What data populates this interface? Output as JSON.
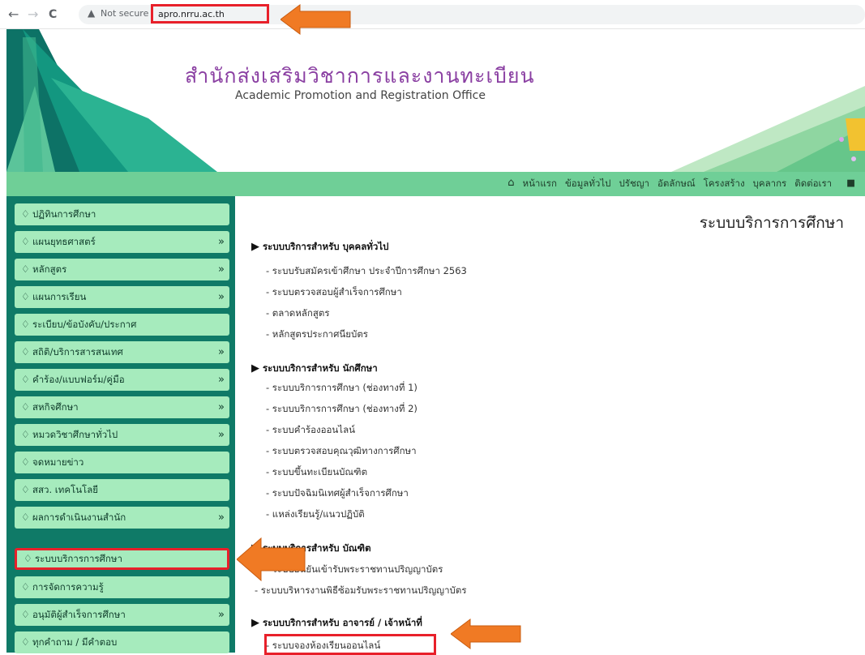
{
  "browser": {
    "back": "←",
    "forward": "→",
    "reload": "C",
    "security_label": "Not secure",
    "url": "apro.nrru.ac.th"
  },
  "header": {
    "title": "สำนักส่งเสริมวิชาการและงานทะเบียน",
    "subtitle": "Academic Promotion and Registration Office"
  },
  "topnav": {
    "items": [
      "หน้าแรก",
      "ข้อมูลทั่วไป",
      "ปรัชญา",
      "อัตลักษณ์",
      "โครงสร้าง",
      "บุคลากร",
      "ติดต่อเรา"
    ]
  },
  "sidebar": {
    "items": [
      {
        "label": "ปฏิทินการศึกษา",
        "chev": ""
      },
      {
        "label": "แผนยุทธศาสตร์",
        "chev": "»"
      },
      {
        "label": "หลักสูตร",
        "chev": "»"
      },
      {
        "label": "แผนการเรียน",
        "chev": "»"
      },
      {
        "label": "ระเบียบ/ข้อบังคับ/ประกาศ",
        "chev": ""
      },
      {
        "label": "สถิติ/บริการสารสนเทศ",
        "chev": "»"
      },
      {
        "label": "คำร้อง/แบบฟอร์ม/คู่มือ",
        "chev": "»"
      },
      {
        "label": "สหกิจศึกษา",
        "chev": "»"
      },
      {
        "label": "หมวดวิชาศึกษาทั่วไป",
        "chev": "»"
      },
      {
        "label": "จดหมายข่าว",
        "chev": ""
      },
      {
        "label": "สสว. เทคโนโลยี",
        "chev": ""
      },
      {
        "label": "ผลการดำเนินงานสำนัก",
        "chev": "»"
      },
      {
        "label": "ระบบบริการการศึกษา",
        "chev": ""
      },
      {
        "label": "การจัดการความรู้",
        "chev": ""
      },
      {
        "label": "อนุมัติผู้สำเร็จการศึกษา",
        "chev": "»"
      },
      {
        "label": "ทุกคำถาม / มีคำตอบ",
        "chev": ""
      }
    ]
  },
  "main": {
    "heading": "ระบบบริการการศึกษา",
    "sections": [
      {
        "title": "ระบบบริการสำหรับ บุคคลทั่วไป",
        "items": [
          "- ระบบรับสมัครเข้าศึกษา ประจำปีการศึกษา 2563",
          "- ระบบตรวจสอบผู้สำเร็จการศึกษา",
          "- ตลาดหลักสูตร",
          "- หลักสูตรประกาศนียบัตร"
        ]
      },
      {
        "title": "ระบบบริการสำหรับ นักศึกษา",
        "items": [
          "- ระบบบริการการศึกษา (ช่องทางที่ 1)",
          "- ระบบบริการการศึกษา (ช่องทางที่ 2)",
          "- ระบบคำร้องออนไลน์",
          "- ระบบตรวจสอบคุณวุฒิทางการศึกษา",
          "- ระบบขึ้นทะเบียนบัณฑิต",
          "- ระบบปัจฉิมนิเทศผู้สำเร็จการศึกษา",
          "- แหล่งเรียนรู้/แนวปฏิบัติ"
        ]
      },
      {
        "title": "ระบบบริการสำหรับ บัณฑิต",
        "items": [
          "- ระบบยืนยันเข้ารับพระราชทานปริญญาบัตร",
          "- ระบบบริหารงานพิธีซ้อมรับพระราชทานปริญญาบัตร"
        ]
      },
      {
        "title": "ระบบบริการสำหรับ อาจารย์ / เจ้าหน้าที่",
        "items": [
          "- ระบบจองห้องเรียนออนไลน์"
        ]
      }
    ]
  },
  "colors": {
    "sidebar_bg": "#0f7a67",
    "sidebar_item": "#a6ebbd",
    "nav_strip": "#6fcf97",
    "highlight": "#e8202a",
    "arrow": "#f07a24",
    "title": "#8a3fa2"
  }
}
